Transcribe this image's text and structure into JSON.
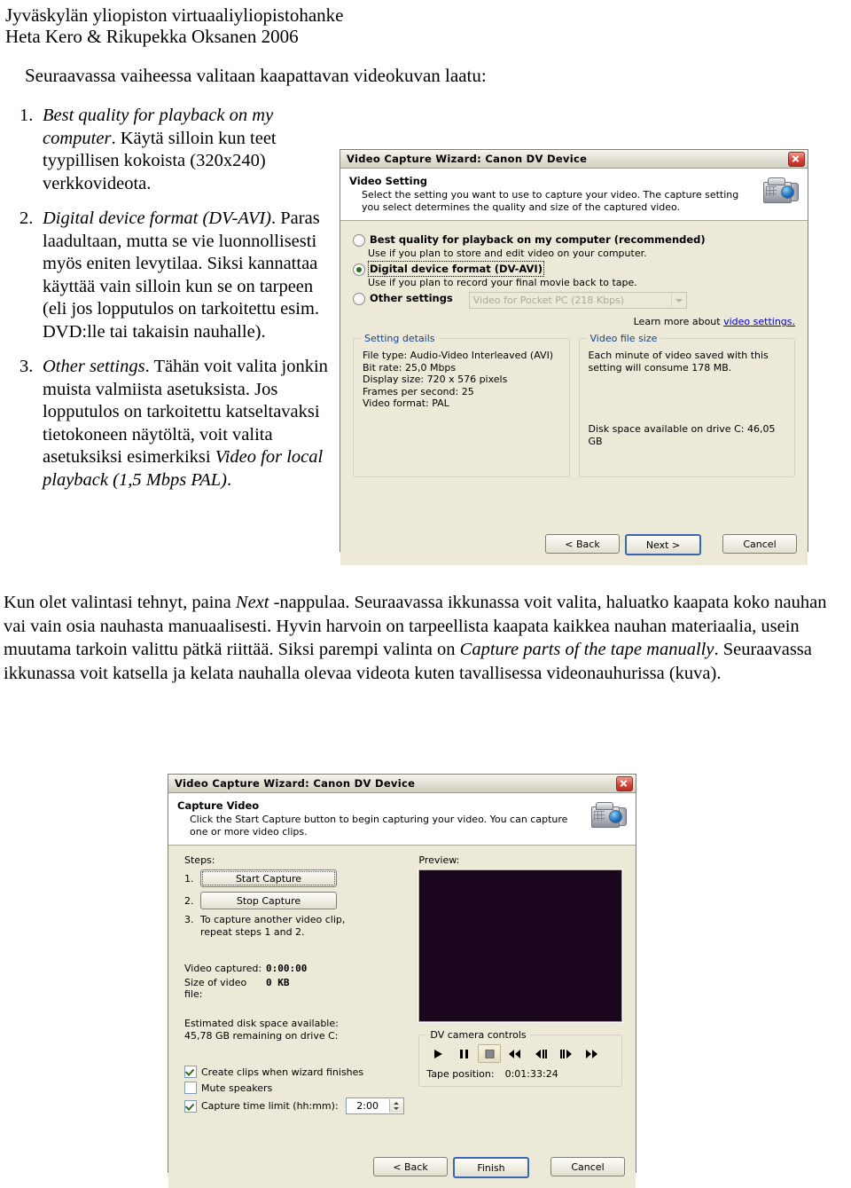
{
  "header": {
    "line1": "Jyväskylän yliopiston virtuaaliyliopistohanke",
    "line2": "Heta Kero & Rikupekka Oksanen 2006"
  },
  "intro": "Seuraavassa vaiheessa valitaan kaapattavan videokuvan laatu:",
  "list": [
    {
      "num": "1.",
      "italic": "Best quality for playback on my computer",
      "rest": ". Käytä silloin kun teet tyypillisen kokoista (320x240) verkkovideota."
    },
    {
      "num": "2.",
      "italic": "Digital device format (DV-AVI)",
      "rest": ". Paras laadultaan, mutta se vie luonnollisesti myös eniten levytilaa. Siksi kannattaa käyttää vain silloin kun se on tarpeen (eli jos lopputulos on tarkoitettu esim. DVD:lle tai takaisin nauhalle)."
    },
    {
      "num": "3.",
      "italic": "Other settings",
      "rest": ". Tähän voit valita jonkin muista valmiista asetuksista. Jos lopputulos on tarkoitettu katseltavaksi tietokoneen näytöltä, voit valita asetuksiksi esimerkiksi ",
      "italic2": "Video for local playback (1,5 Mbps PAL)",
      "rest2": "."
    }
  ],
  "paragraph": {
    "p1a": "Kun olet valintasi tehnyt, paina ",
    "p1i": "Next",
    "p1b": " -nappulaa. Seuraavassa ikkunassa voit valita, haluatko kaapata koko nauhan vai vain osia nauhasta manuaalisesti. Hyvin harvoin on tarpeellista kaapata kaikkea nauhan materiaalia, usein muutama tarkoin valittu pätkä riittää. Siksi parempi valinta on ",
    "p1i2": "Capture parts of the tape manually",
    "p1c": ". Seuraavassa ikkunassa voit katsella ja kelata nauhalla olevaa videota kuten tavallisessa videonauhurissa (kuva)."
  },
  "dialog1": {
    "title": "Video Capture Wizard: Canon DV Device",
    "banner_heading": "Video Setting",
    "banner_text": "Select the setting you want to use to capture your video. The capture setting you select determines the quality and size of the captured video.",
    "options": [
      {
        "label": "Best quality for playback on my computer (recommended)",
        "desc": "Use if you plan to store and edit video on your computer.",
        "selected": false
      },
      {
        "label": "Digital device format (DV-AVI)",
        "desc": "Use if you plan to record your final movie back to tape.",
        "selected": true
      },
      {
        "label": "Other settings",
        "desc": "",
        "selected": false
      }
    ],
    "combo_value": "Video for Pocket PC (218 Kbps)",
    "learn_more_prefix": "Learn more about ",
    "learn_more_link": "video settings.",
    "setting_details": {
      "legend": "Setting details",
      "lines": [
        "File type: Audio-Video Interleaved (AVI)",
        "Bit rate: 25,0 Mbps",
        "Display size: 720 x 576 pixels",
        "Frames per second: 25",
        "Video format: PAL"
      ]
    },
    "video_file_size": {
      "legend": "Video file size",
      "line1": "Each minute of video saved with this setting will consume 178 MB.",
      "line2": "Disk space available on drive C: 46,05 GB"
    },
    "buttons": {
      "back": "< Back",
      "next": "Next >",
      "cancel": "Cancel"
    }
  },
  "dialog2": {
    "title": "Video Capture Wizard: Canon DV Device",
    "banner_heading": "Capture Video",
    "banner_text": "Click the Start Capture button to begin capturing your video. You can capture one or more video clips.",
    "steps_label": "Steps:",
    "preview_label": "Preview:",
    "steps": [
      {
        "num": "1.",
        "label": "Start Capture"
      },
      {
        "num": "2.",
        "label": "Stop Capture"
      }
    ],
    "step3_num": "3.",
    "step3_text": "To capture another video clip, repeat steps 1 and 2.",
    "stats": [
      {
        "label": "Video captured:",
        "value": "0:00:00"
      },
      {
        "label": "Size of video file:",
        "value": "0 KB"
      }
    ],
    "disk_line1": "Estimated disk space available:",
    "disk_line2": "45,78 GB remaining on drive C:",
    "checks": [
      {
        "label": "Create clips when wizard finishes",
        "checked": true
      },
      {
        "label": "Mute speakers",
        "checked": false
      },
      {
        "label": "Capture time limit (hh:mm):",
        "checked": true
      }
    ],
    "time_limit_value": "2:00",
    "dv_controls": {
      "legend": "DV camera controls",
      "tape_label": "Tape position:",
      "tape_value": "0:01:33:24",
      "buttons": [
        "play-icon",
        "pause-icon",
        "stop-icon",
        "rewind-icon",
        "step-back-icon",
        "step-forward-icon",
        "fast-forward-icon"
      ]
    },
    "buttons": {
      "back": "< Back",
      "finish": "Finish",
      "cancel": "Cancel"
    }
  },
  "colors": {
    "dialog_face": "#ece9d8",
    "link": "#0000c8",
    "group_legend": "#15428b",
    "radio_dot": "#2c6b18",
    "preview_black": "#1a071d"
  }
}
